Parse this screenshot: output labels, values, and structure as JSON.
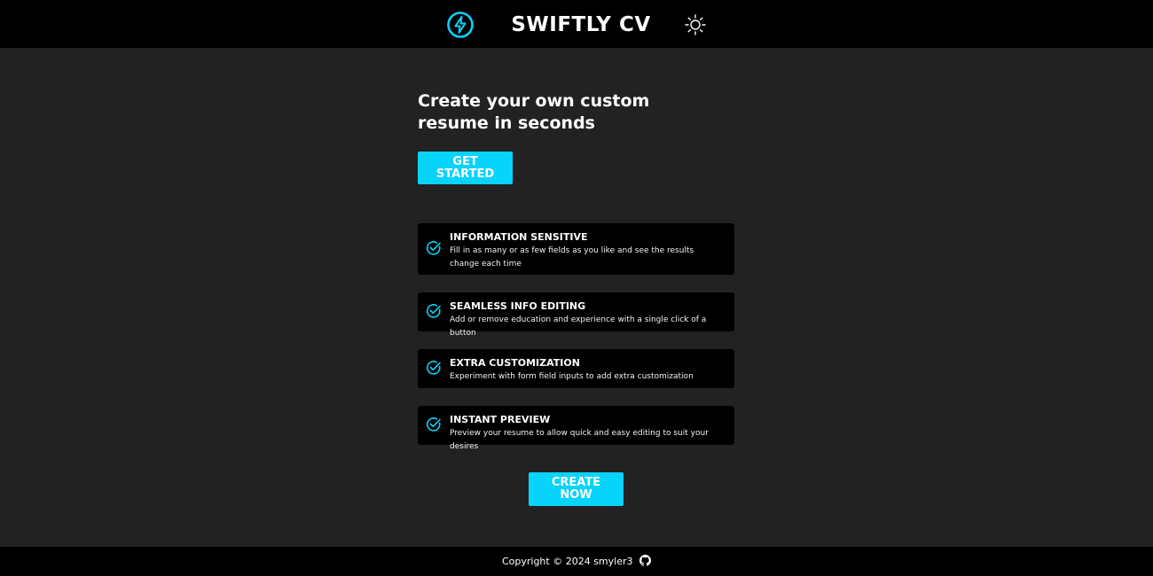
{
  "header": {
    "logo_icon": "lightning-bolt-icon",
    "title": "SWIFTLY CV",
    "theme_toggle_icon": "sun-icon"
  },
  "hero": {
    "headline": "Create your own custom resume in seconds",
    "get_started_label": "GET STARTED"
  },
  "features": [
    {
      "icon": "check-circle-icon",
      "title": "INFORMATION SENSITIVE",
      "description": "Fill in as many or as few fields as you like and see the results change each time"
    },
    {
      "icon": "check-circle-icon",
      "title": "SEAMLESS INFO EDITING",
      "description": "Add or remove education and experience with a single click of a button"
    },
    {
      "icon": "check-circle-icon",
      "title": "EXTRA CUSTOMIZATION",
      "description": "Experiment with form field inputs to add extra customization"
    },
    {
      "icon": "check-circle-icon",
      "title": "INSTANT PREVIEW",
      "description": "Preview your resume to allow quick and easy editing to suit your desires"
    }
  ],
  "cta": {
    "create_now_label": "CREATE NOW"
  },
  "footer": {
    "copyright": "Copyright © 2024 smyler3",
    "github_icon": "github-icon"
  },
  "colors": {
    "accent": "#08d3fb",
    "background": "#222222",
    "bar": "#000000"
  }
}
